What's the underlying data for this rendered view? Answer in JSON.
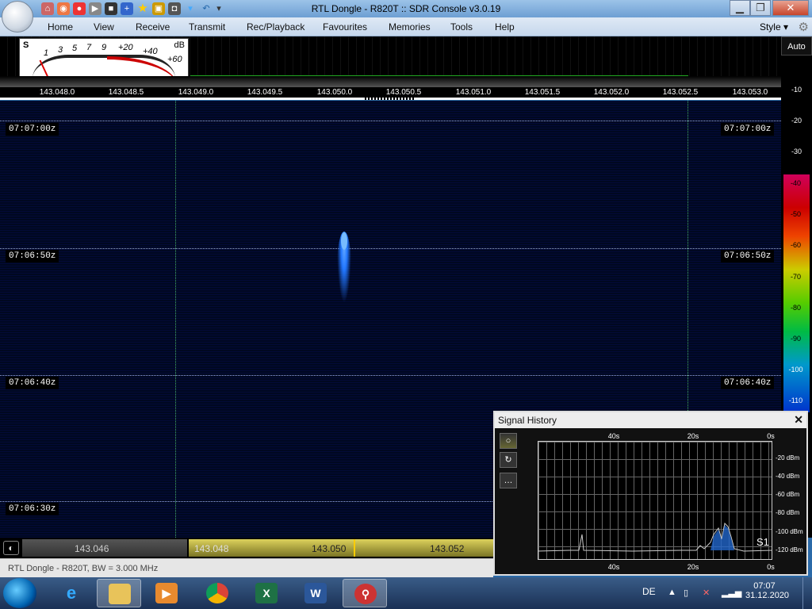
{
  "window": {
    "title": "RTL Dongle - R820T :: SDR Console v3.0.19",
    "min_icon": "minimize-icon",
    "max_icon": "maximize-icon",
    "close_icon": "close-icon"
  },
  "menu": {
    "items": [
      "Home",
      "View",
      "Receive",
      "Transmit",
      "Rec/Playback",
      "Favourites",
      "Memories",
      "Tools",
      "Help"
    ],
    "style_label": "Style"
  },
  "meter": {
    "s_label": "S",
    "db_label": "dB",
    "scale": [
      "1",
      "3",
      "5",
      "7",
      "9",
      "+20",
      "+40",
      "+60"
    ]
  },
  "freq_axis": [
    "143.048.0",
    "143.048.5",
    "143.049.0",
    "143.049.5",
    "143.050.0",
    "143.050.5",
    "143.051.0",
    "143.051.5",
    "143.052.0",
    "143.052.5",
    "143.053.0"
  ],
  "waterfall": {
    "time_labels": [
      "07:07:00z",
      "07:06:50z",
      "07:06:40z",
      "07:06:30z"
    ]
  },
  "level_scale": {
    "auto_label": "Auto",
    "labels": [
      "-10",
      "-20",
      "-30",
      "-40",
      "-50",
      "-60",
      "-70",
      "-80",
      "-90",
      "-100",
      "-110"
    ]
  },
  "tuning": {
    "freqs": [
      "143.046",
      "143.048",
      "143.050",
      "143.052"
    ]
  },
  "status": {
    "text": "RTL Dongle - R820T, BW = 3.000 MHz"
  },
  "signal_history": {
    "title": "Signal History",
    "x_labels": [
      "40s",
      "20s",
      "0s"
    ],
    "y_labels": [
      "-20 dBm",
      "-40 dBm",
      "-60 dBm",
      "-80 dBm",
      "-100 dBm",
      "-120 dBm"
    ],
    "s_reading": "S1",
    "buttons": [
      "○",
      "↻",
      "…"
    ]
  },
  "taskbar": {
    "lang": "DE",
    "time": "07:07",
    "date": "31.12.2020",
    "apps": [
      "internet-explorer",
      "file-explorer",
      "media-player",
      "chrome",
      "excel",
      "word",
      "sdr-console"
    ]
  }
}
